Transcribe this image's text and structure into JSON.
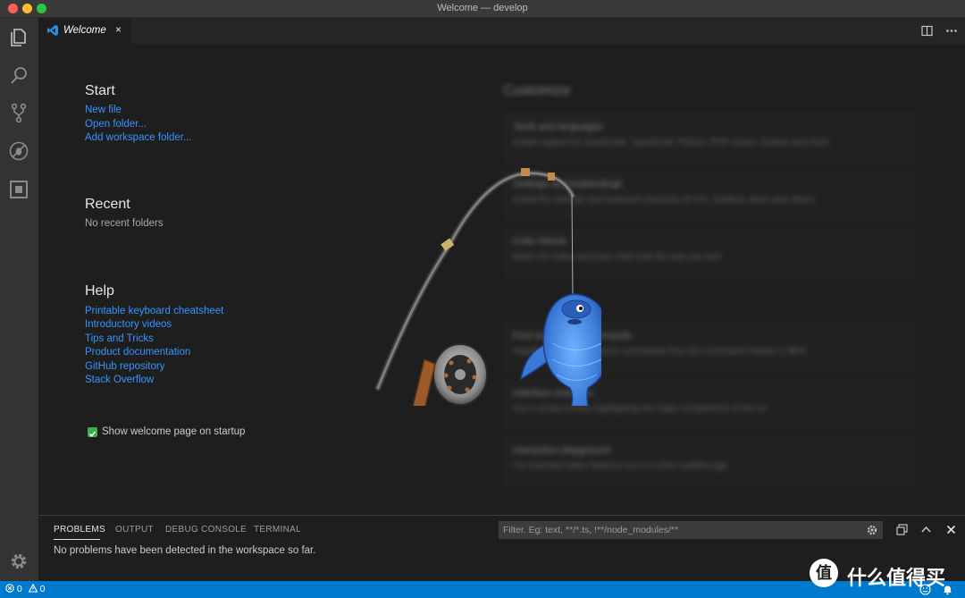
{
  "window": {
    "title": "Welcome — develop"
  },
  "activity_bar": {
    "items": [
      "files-icon",
      "search-icon",
      "source-control-icon",
      "debug-icon",
      "extensions-icon"
    ],
    "bottom": "gear-icon"
  },
  "tab": {
    "label": "Welcome",
    "close": "×"
  },
  "welcome": {
    "start": {
      "title": "Start",
      "links": [
        "New file",
        "Open folder...",
        "Add workspace folder..."
      ]
    },
    "recent": {
      "title": "Recent",
      "empty": "No recent folders"
    },
    "help": {
      "title": "Help",
      "links": [
        "Printable keyboard cheatsheet",
        "Introductory videos",
        "Tips and Tricks",
        "Product documentation",
        "GitHub repository",
        "Stack Overflow"
      ]
    },
    "startup_checkbox": {
      "label": "Show welcome page on startup",
      "checked": true
    }
  },
  "customize": {
    "title": "Customize",
    "cards": [
      {
        "heading": "Tools and languages",
        "text": "Install support for JavaScript, TypeScript, Python, PHP, Azure, Docker and more"
      },
      {
        "heading": "Settings and keybindings",
        "text": "Install the settings and keyboard shortcuts of Vim, Sublime, Atom and others"
      },
      {
        "heading": "Color theme",
        "text": "Make the editor and your code look the way you love"
      },
      {
        "heading": "Find and run all commands",
        "text": "Rapidly access and search commands from the Command Palette (⇧⌘P)"
      },
      {
        "heading": "Interface overview",
        "text": "Get a visual overlay highlighting the major components of the UI"
      },
      {
        "heading": "Interactive playground",
        "text": "Try essential editor features out in a short walkthrough"
      }
    ]
  },
  "panel": {
    "tabs": [
      "PROBLEMS",
      "OUTPUT",
      "DEBUG CONSOLE",
      "TERMINAL"
    ],
    "active_tab": "PROBLEMS",
    "filter_placeholder": "Filter. Eg: text, **/*.ts, !**/node_modules/**",
    "message": "No problems have been detected in the workspace so far."
  },
  "status_bar": {
    "errors": "0",
    "warnings": "0"
  },
  "watermark": {
    "text": "什么值得买",
    "logo": "值"
  },
  "colors": {
    "accent": "#007acc",
    "link": "#3794ff",
    "fish": "#3f7fd6"
  }
}
